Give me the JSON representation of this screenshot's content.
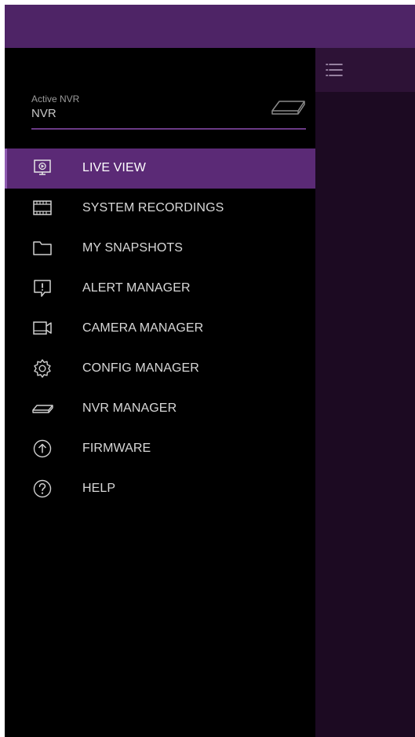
{
  "drawer": {
    "active_nvr_caption": "Active NVR",
    "active_nvr_value": "NVR",
    "device_icon": "nvr-device-icon",
    "items": [
      {
        "label": "LIVE VIEW",
        "icon": "monitor-icon",
        "active": true
      },
      {
        "label": "SYSTEM RECORDINGS",
        "icon": "film-icon",
        "active": false
      },
      {
        "label": "MY SNAPSHOTS",
        "icon": "folder-icon",
        "active": false
      },
      {
        "label": "ALERT MANAGER",
        "icon": "alert-icon",
        "active": false
      },
      {
        "label": "CAMERA MANAGER",
        "icon": "camera-icon",
        "active": false
      },
      {
        "label": "CONFIG MANAGER",
        "icon": "gear-icon",
        "active": false
      },
      {
        "label": "NVR MANAGER",
        "icon": "nvr-icon",
        "active": false
      },
      {
        "label": "FIRMWARE",
        "icon": "upload-icon",
        "active": false
      },
      {
        "label": "HELP",
        "icon": "help-icon",
        "active": false
      }
    ]
  },
  "toolbar": {
    "menu_icon": "hamburger-icon"
  },
  "colors": {
    "status_bar": "#4e2466",
    "active_item": "#5b2a76",
    "right_toolbar": "#2d1236",
    "right_pane": "#1c0a22",
    "accent_line": "#6a3a85"
  }
}
